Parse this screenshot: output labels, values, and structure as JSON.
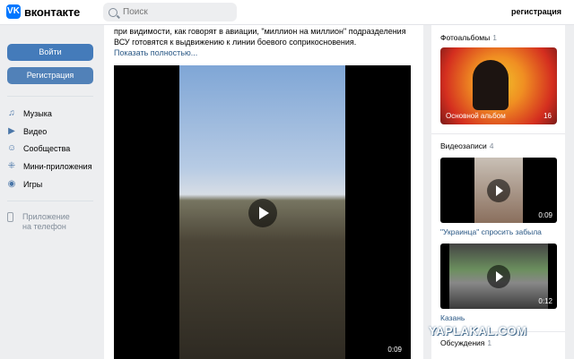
{
  "header": {
    "logo_mark": "VK",
    "logo_text": "вконтакте",
    "search_placeholder": "Поиск",
    "register_link": "регистрация"
  },
  "sidebar": {
    "login_button": "Войти",
    "register_button": "Регистрация",
    "items": [
      {
        "label": "Музыка",
        "icon": "music-icon"
      },
      {
        "label": "Видео",
        "icon": "video-icon"
      },
      {
        "label": "Сообщества",
        "icon": "communities-icon"
      },
      {
        "label": "Мини-приложения",
        "icon": "apps-icon"
      },
      {
        "label": "Игры",
        "icon": "games-icon"
      }
    ],
    "app_line1": "Приложение",
    "app_line2": "на телефон"
  },
  "post": {
    "text": "при видимости, как говорят в авиации, \"миллион на миллион\" подразделения ВСУ готовятся к выдвижению к линии боевого соприкосновения.",
    "show_more": "Показать полностью...",
    "video_duration": "0:09"
  },
  "right": {
    "photos_title": "Фотоальбомы",
    "photos_count": "1",
    "album_name": "Основной альбом",
    "album_count": "16",
    "videos_title": "Видеозаписи",
    "videos_count": "4",
    "videos": [
      {
        "caption": "\"Украинца\" спросить забыла",
        "duration": "0:09"
      },
      {
        "caption": "Казань",
        "duration": "0:12"
      }
    ],
    "discussions_title": "Обсуждения",
    "discussions_count": "1"
  },
  "watermark": "YAPLAKAL.COM",
  "colors": {
    "accent": "#447bba",
    "link": "#2a5885",
    "background": "#edeef0"
  }
}
